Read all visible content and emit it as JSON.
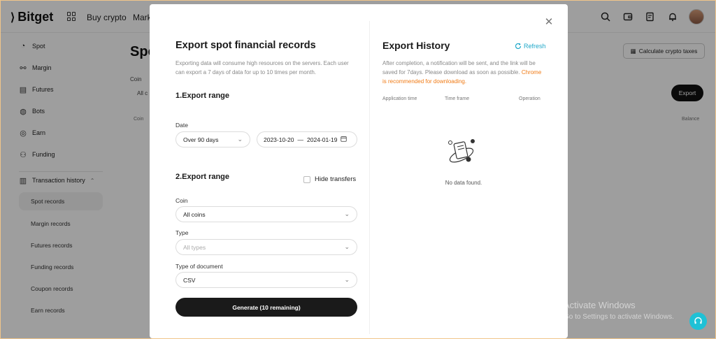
{
  "nav": {
    "brand": "Bitget",
    "links": [
      "Buy crypto",
      "Mark"
    ]
  },
  "sidebar": {
    "items": [
      {
        "label": "Spot",
        "icon": "spot-icon"
      },
      {
        "label": "Margin",
        "icon": "margin-icon"
      },
      {
        "label": "Futures",
        "icon": "futures-icon"
      },
      {
        "label": "Bots",
        "icon": "bots-icon"
      },
      {
        "label": "Earn",
        "icon": "earn-icon"
      },
      {
        "label": "Funding",
        "icon": "funding-icon"
      }
    ],
    "history_label": "Transaction history",
    "sub_items": [
      "Spot records",
      "Margin records",
      "Futures records",
      "Funding records",
      "Coupon records",
      "Earn records"
    ]
  },
  "page": {
    "title": "Spot",
    "coin_label": "Coin",
    "coin_value": "All c",
    "col_coin": "Coin",
    "col_balance": "Balance",
    "calc_taxes": "Calculate crypto taxes",
    "export_button": "Export"
  },
  "modal": {
    "title": "Export spot financial records",
    "description": "Exporting data will consume high resources on the servers. Each user can export a 7 days of data for up to 10 times per month.",
    "section1": "1.Export range",
    "date_label": "Date",
    "date_select": "Over 90 days",
    "range_start": "2023-10-20",
    "range_sep": "—",
    "range_end": "2024-01-19",
    "section2": "2.Export range",
    "hide_transfers": "Hide transfers",
    "coin_label": "Coin",
    "coin_value": "All coins",
    "type_label": "Type",
    "type_placeholder": "All types",
    "doc_label": "Type of document",
    "doc_value": "CSV",
    "generate_button": "Generate (10 remaining)"
  },
  "history": {
    "title": "Export History",
    "refresh": "Refresh",
    "description": "After completion, a notification will be sent, and the link will be saved for 7days. Please download as soon as possible.",
    "warning": "Chrome is recommended for downloading.",
    "columns": [
      "Application time",
      "Time frame",
      "Operation"
    ],
    "empty": "No data found."
  },
  "watermark": {
    "line1": "Activate Windows",
    "line2": "Go to Settings to activate Windows."
  },
  "colors": {
    "accent": "#1fa8c9",
    "warning": "#f07a14",
    "primary_button": "#1a1a1a"
  }
}
